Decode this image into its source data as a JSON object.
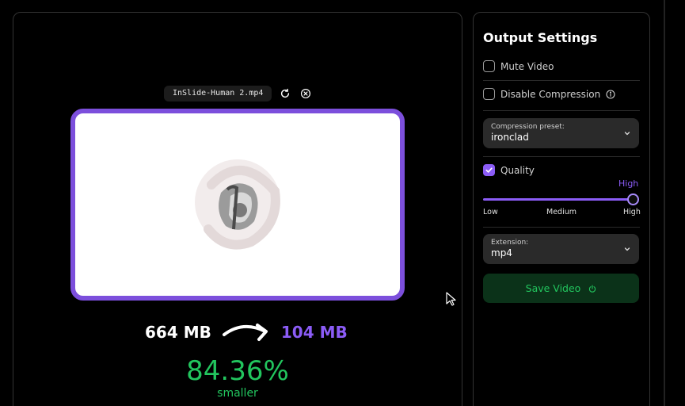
{
  "preview": {
    "file_name": "InSlide-Human 2.mp4",
    "reload_icon": "reload-icon",
    "remove_icon": "close-circle-icon",
    "original_size": "664 MB",
    "compressed_size": "104 MB",
    "reduction_percent": "84.36%",
    "reduction_label": "smaller"
  },
  "settings": {
    "title": "Output Settings",
    "mute_video": {
      "label": "Mute Video",
      "checked": false
    },
    "disable_compression": {
      "label": "Disable Compression",
      "checked": false
    },
    "compression_preset": {
      "label": "Compression preset:",
      "value": "ironclad"
    },
    "quality": {
      "label": "Quality",
      "checked": true,
      "current": "High",
      "level": 1.0,
      "ticks": [
        "Low",
        "Medium",
        "High"
      ]
    },
    "extension": {
      "label": "Extension:",
      "value": "mp4"
    },
    "save_label": "Save Video"
  },
  "colors": {
    "accent": "#8b5cf6",
    "success": "#22c55e",
    "save_bg": "#0b3219",
    "frame_border": "#7c4fdc"
  }
}
